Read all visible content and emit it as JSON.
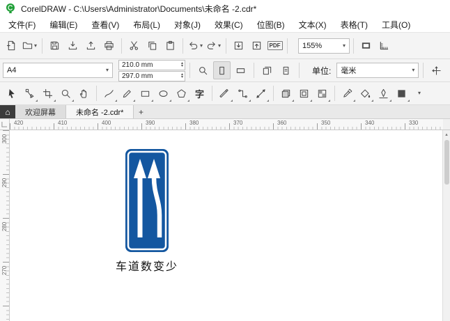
{
  "titlebar": {
    "title": "CorelDRAW - C:\\Users\\Administrator\\Documents\\未命名 -2.cdr*"
  },
  "menu": {
    "items": [
      "文件(F)",
      "编辑(E)",
      "查看(V)",
      "布局(L)",
      "对象(J)",
      "效果(C)",
      "位图(B)",
      "文本(X)",
      "表格(T)",
      "工具(O)"
    ]
  },
  "toolbar": {
    "zoom_level": "155%",
    "pdf_label": "PDF"
  },
  "property_bar": {
    "preset": "A4",
    "width": "210.0 mm",
    "height": "297.0 mm",
    "units_label": "单位:",
    "units_value": "毫米"
  },
  "tools": {
    "text_tool_glyph": "字"
  },
  "tabbar": {
    "home_glyph": "⌂",
    "tabs": [
      {
        "label": "欢迎屏幕"
      },
      {
        "label": "未命名 -2.cdr*"
      }
    ],
    "new_tab_label": "+"
  },
  "rulers": {
    "horizontal": [
      "420",
      "410",
      "400",
      "390",
      "380",
      "370",
      "360",
      "350",
      "340",
      "330"
    ],
    "vertical": [
      "300",
      "290",
      "280",
      "270"
    ]
  },
  "canvas": {
    "caption": "车道数变少",
    "sign_blue": "#1457A0"
  },
  "icons": {
    "caret": "▾",
    "spin_up": "▴",
    "spin_down": "▾",
    "import_arrow": "↓",
    "export_arrow": "↑"
  }
}
